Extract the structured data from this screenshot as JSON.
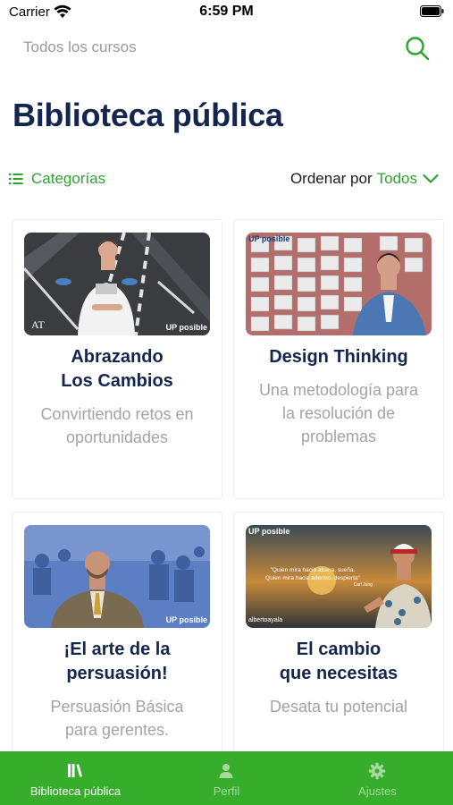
{
  "status_bar": {
    "carrier": "Carrier",
    "time": "6:59 PM"
  },
  "search": {
    "placeholder": "Todos los cursos"
  },
  "page": {
    "title": "Biblioteca pública"
  },
  "filters": {
    "categories_label": "Categorías",
    "sort_prefix": "Ordenar por",
    "sort_value": "Todos"
  },
  "courses": [
    {
      "title_line1": "Abrazando",
      "title_line2": "Los Cambios",
      "subtitle_line1": "Convirtiendo retos en",
      "subtitle_line2": "oportunidades",
      "subtitle_line3": "",
      "brand": "UP posible",
      "watermark": "AT"
    },
    {
      "title_line1": "Design Thinking",
      "title_line2": "",
      "subtitle_line1": "Una metodología para",
      "subtitle_line2": "la resolución de",
      "subtitle_line3": "problemas",
      "brand": "UP posible"
    },
    {
      "title_line1": "¡El arte de la",
      "title_line2": "persuasión!",
      "subtitle_line1": "Persuasión Básica",
      "subtitle_line2": "para gerentes.",
      "subtitle_line3": "",
      "brand": "UP posible"
    },
    {
      "title_line1": "El cambio",
      "title_line2": "que necesitas",
      "subtitle_line1": "Desata tu potencial",
      "subtitle_line2": "",
      "subtitle_line3": "",
      "brand": "UP posible",
      "quote_line1": "\"Quien mira hacia afuera, sueña.",
      "quote_line2": "Quien mira hacia adentro, despierta\"",
      "quote_author": "Carl Jung",
      "author_brand": "albertoayala"
    }
  ],
  "tabbar": {
    "tabs": [
      {
        "label": "Biblioteca pública",
        "icon": "library-icon",
        "active": true
      },
      {
        "label": "Perfil",
        "icon": "person-icon",
        "active": false
      },
      {
        "label": "Ajustes",
        "icon": "gear-icon",
        "active": false
      }
    ]
  },
  "colors": {
    "accent_green": "#37ad2c",
    "title_navy": "#14264e",
    "muted_gray": "#a3a3a3"
  }
}
